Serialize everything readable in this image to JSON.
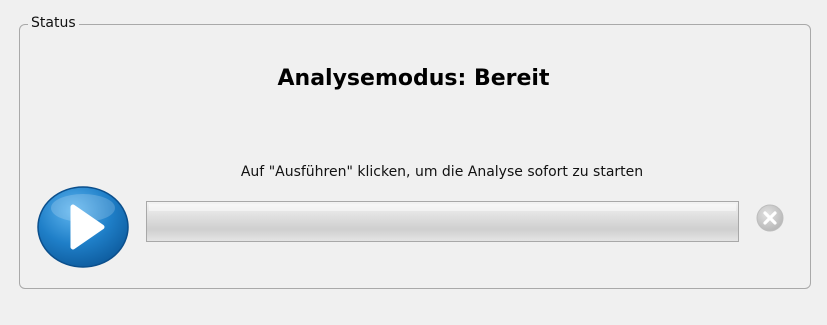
{
  "status_group": {
    "legend": "Status",
    "mode_title": "Analysemodus: Bereit",
    "hint": "Auf \"Ausführen\" klicken, um die Analyse sofort zu starten",
    "progress_fraction": 0
  },
  "buttons": {
    "run_icon": "play-icon",
    "cancel_icon": "close-icon"
  },
  "colors": {
    "run_button": "#1f7fc8",
    "cancel_button": "#c8c8c8"
  }
}
